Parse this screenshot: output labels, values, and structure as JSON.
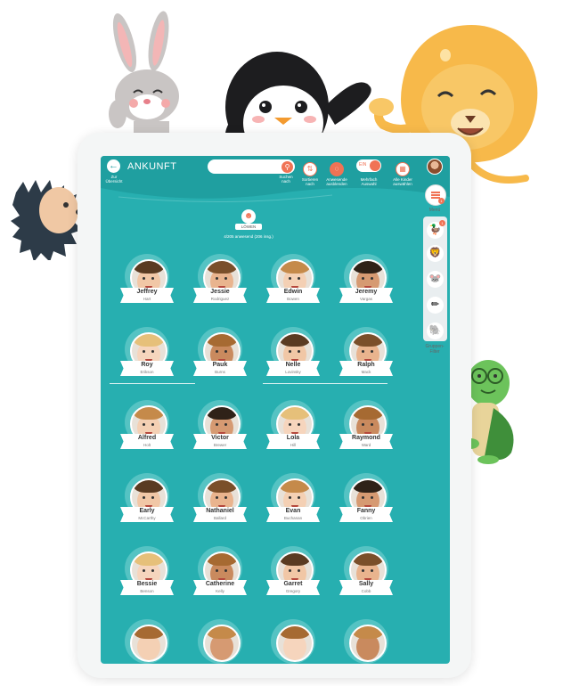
{
  "header": {
    "title": "ANKUNFT",
    "back_label": "Zur Übersicht",
    "search_label": "Suchen nach",
    "sort_label": "Sortieren nach",
    "hide_label": "Anwesende ausblenden",
    "multi_label": "Mehrfach Auswahl",
    "multi_toggle": "EIN",
    "select_all_label": "Alle Kinder auswählen"
  },
  "sidebar": {
    "menu_label": "Menü",
    "menu_badge": "1",
    "filter_badge": "1",
    "filter_label": "Gruppen-Filter"
  },
  "group": {
    "name": "LÖWEN",
    "count": "4/205 anwesend (206 insg.)"
  },
  "children": [
    {
      "first": "Jeffrey",
      "last": "Hart"
    },
    {
      "first": "Jessie",
      "last": "Rodriguez"
    },
    {
      "first": "Edwin",
      "last": "Bowen"
    },
    {
      "first": "Jeremy",
      "last": "Vargas"
    },
    {
      "first": "Roy",
      "last": "Erikson"
    },
    {
      "first": "Pauk",
      "last": "Burns"
    },
    {
      "first": "Nelle",
      "last": "Lovinsky"
    },
    {
      "first": "Ralph",
      "last": "Mack"
    },
    {
      "first": "Alfred",
      "last": "Holt"
    },
    {
      "first": "Victor",
      "last": "Brewer"
    },
    {
      "first": "Lola",
      "last": "Hill"
    },
    {
      "first": "Raymond",
      "last": "Ward"
    },
    {
      "first": "Early",
      "last": "McCarthy"
    },
    {
      "first": "Nathaniel",
      "last": "Ballard"
    },
    {
      "first": "Evan",
      "last": "Buchanan"
    },
    {
      "first": "Fanny",
      "last": "Obrien"
    },
    {
      "first": "Bessie",
      "last": "Benson"
    },
    {
      "first": "Catherine",
      "last": "Kelly"
    },
    {
      "first": "Garret",
      "last": "Gregory"
    },
    {
      "first": "Sally",
      "last": "Cobb"
    }
  ],
  "colors": {
    "teal": "#27afb0",
    "accent": "#f07355"
  }
}
